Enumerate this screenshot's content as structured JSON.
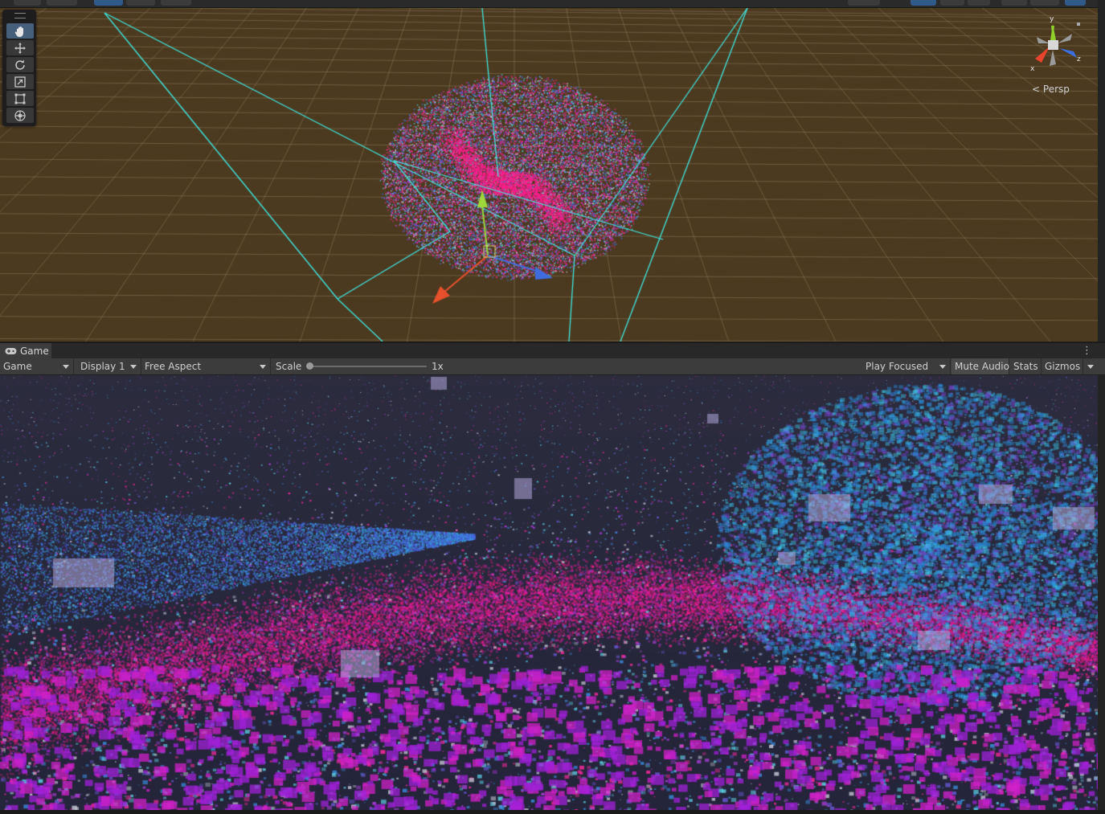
{
  "scene": {
    "persp_label": "Persp",
    "gizmo_axes": {
      "y": "y",
      "x": "x",
      "z": "z"
    },
    "tools": [
      {
        "name": "hand-tool",
        "icon": "hand-icon",
        "active": true
      },
      {
        "name": "move-tool",
        "icon": "move-icon",
        "active": false
      },
      {
        "name": "rotate-tool",
        "icon": "rotate-icon",
        "active": false
      },
      {
        "name": "scale-tool",
        "icon": "scale-icon",
        "active": false
      },
      {
        "name": "rect-tool",
        "icon": "rect-icon",
        "active": false
      },
      {
        "name": "transform-tool",
        "icon": "transform-icon",
        "active": false
      }
    ],
    "colors": {
      "background": "#4b3a20",
      "grid": "#6a5a3e",
      "camera_frustum": "#3fe7e0"
    }
  },
  "game": {
    "tab_label": "Game",
    "toolbar": {
      "view_select": "Game",
      "display": "Display 1",
      "aspect": "Free Aspect",
      "scale_label": "Scale",
      "scale_value": "1x",
      "play_focused": "Play Focused",
      "mute_audio": "Mute Audio",
      "stats": "Stats",
      "gizmos": "Gizmos"
    },
    "colors": {
      "background": "#2a2a3a",
      "pink": "#ff1a8c",
      "blue": "#2a7ad8",
      "cyan": "#3fd0e8",
      "violet": "#7a2ad8"
    }
  }
}
